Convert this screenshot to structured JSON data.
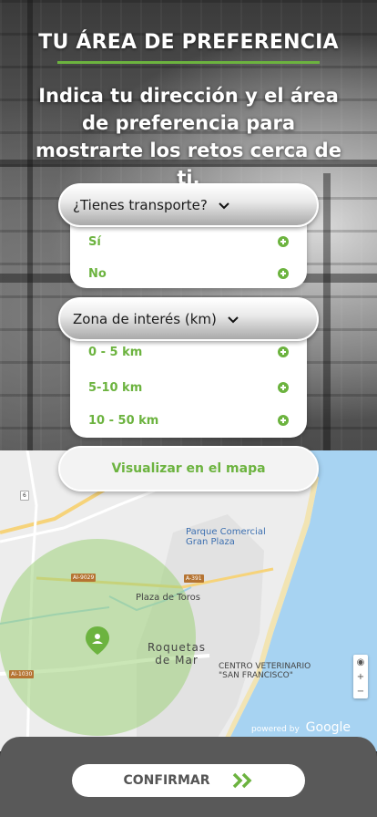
{
  "title": "TU ÁREA DE PREFERENCIA",
  "subtitle": "Indica tu dirección y el área de preferencia para mostrarte los retos cerca de ti.",
  "transport": {
    "label": "¿Tienes transporte?",
    "options": [
      "Sí",
      "No"
    ]
  },
  "zone": {
    "label": "Zona de interés (km)",
    "options": [
      "0 - 5 km",
      "5-10 km",
      "10 - 50 km"
    ]
  },
  "visualize_button": "Visualizar en el mapa",
  "map": {
    "labels": {
      "parque_line1": "Parque Comercial",
      "parque_line2": "Gran Plaza",
      "plaza_toros": "Plaza de Toros",
      "roquetas_line1": "Roquetas",
      "roquetas_line2": "de Mar",
      "vet_line1": "CENTRO VETERINARIO",
      "vet_line2": "\"SAN FRANCISCO\"",
      "powered_by": "powered by",
      "google": "Google"
    },
    "road_badges": [
      "6",
      "AI-9029",
      "A-391",
      "AI-1030"
    ],
    "zoom": {
      "target": "◉",
      "plus": "+",
      "minus": "−"
    }
  },
  "confirm_button": "CONFIRMAR",
  "colors": {
    "accent": "#6cb33f",
    "footer": "#595959",
    "sea": "#a7d3f2",
    "radius": "#9fd27a"
  }
}
